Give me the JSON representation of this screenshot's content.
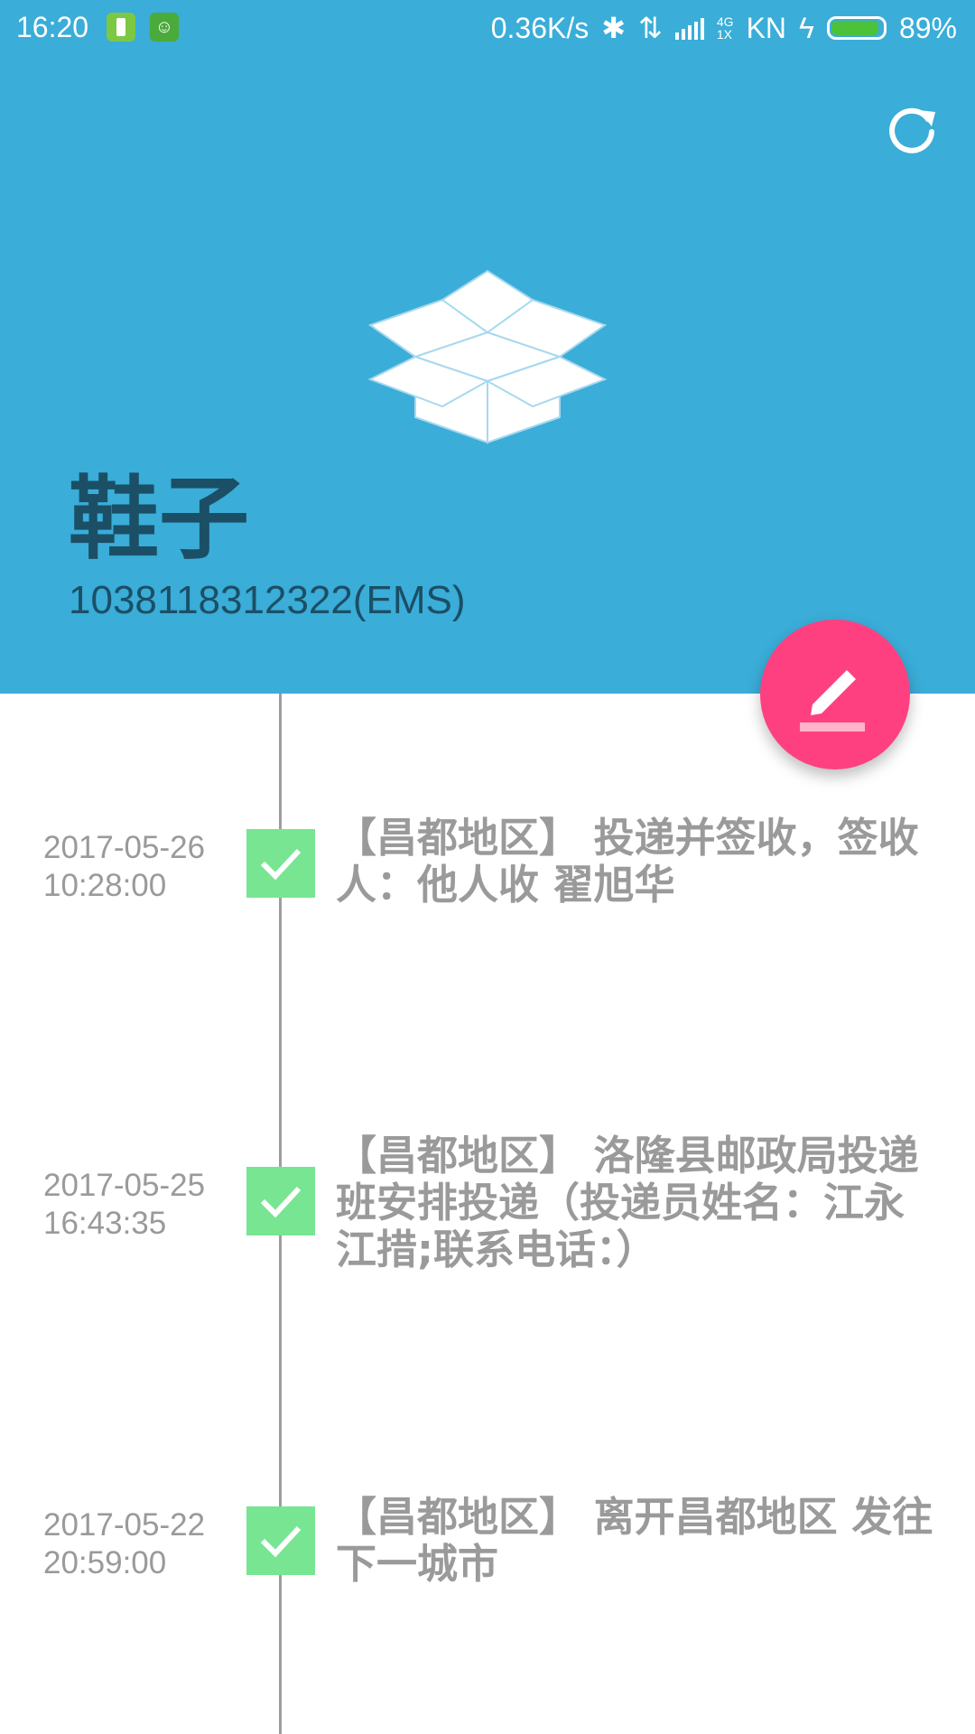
{
  "statusbar": {
    "time": "16:20",
    "speed": "0.36K/s",
    "network_top": "4G",
    "network_bottom": "1X",
    "carrier": "KN",
    "battery": "89%"
  },
  "header": {
    "refresh_icon": "refresh-icon",
    "box_icon": "package-box-icon",
    "title": "鞋子",
    "tracking": "1038118312322(EMS)",
    "fab_icon": "edit-pencil-icon",
    "background": "#3aadd8",
    "fab_color": "#ff4080"
  },
  "timeline": [
    {
      "date": "2017-05-26",
      "time": "10:28:00",
      "text": "【昌都地区】 投递并签收，签收人：他人收 翟旭华"
    },
    {
      "date": "2017-05-25",
      "time": "16:43:35",
      "text": "【昌都地区】 洛隆县邮政局投递班安排投递（投递员姓名：江永江措;联系电话：）"
    },
    {
      "date": "2017-05-22",
      "time": "20:59:00",
      "text": "【昌都地区】 离开昌都地区 发往下一城市"
    }
  ]
}
